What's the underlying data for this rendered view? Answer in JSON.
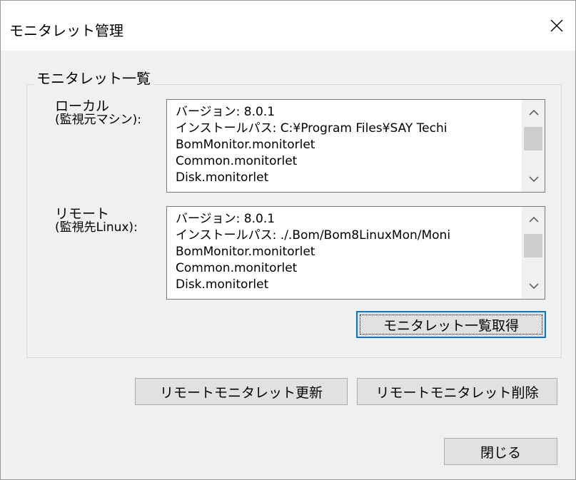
{
  "window": {
    "title": "モニタレット管理",
    "close_icon": "close-icon"
  },
  "group": {
    "legend": "モニタレット一覧"
  },
  "local": {
    "label_line1": "ローカル",
    "label_line2": "(監視元マシン):",
    "lines": [
      "バージョン: 8.0.1",
      "インストールパス: C:¥Program Files¥SAY Techi",
      "BomMonitor.monitorlet",
      "Common.monitorlet",
      "Disk.monitorlet"
    ]
  },
  "remote": {
    "label_line1": "リモート",
    "label_line2": "(監視先Linux):",
    "lines": [
      "バージョン: 8.0.1",
      "インストールパス: ./.Bom/Bom8LinuxMon/Moni",
      "BomMonitor.monitorlet",
      "Common.monitorlet",
      "Disk.monitorlet"
    ]
  },
  "buttons": {
    "fetch_list": "モニタレット一覧取得",
    "update_remote": "リモートモニタレット更新",
    "delete_remote": "リモートモニタレット削除",
    "close": "閉じる"
  },
  "icons": {
    "scroll_up": "chevron-up-icon",
    "scroll_down": "chevron-down-icon"
  },
  "colors": {
    "window_bg": "#f0f0f0",
    "titlebar_bg": "#ffffff",
    "default_button_border": "#0078d7",
    "button_bg": "#e1e1e1"
  }
}
